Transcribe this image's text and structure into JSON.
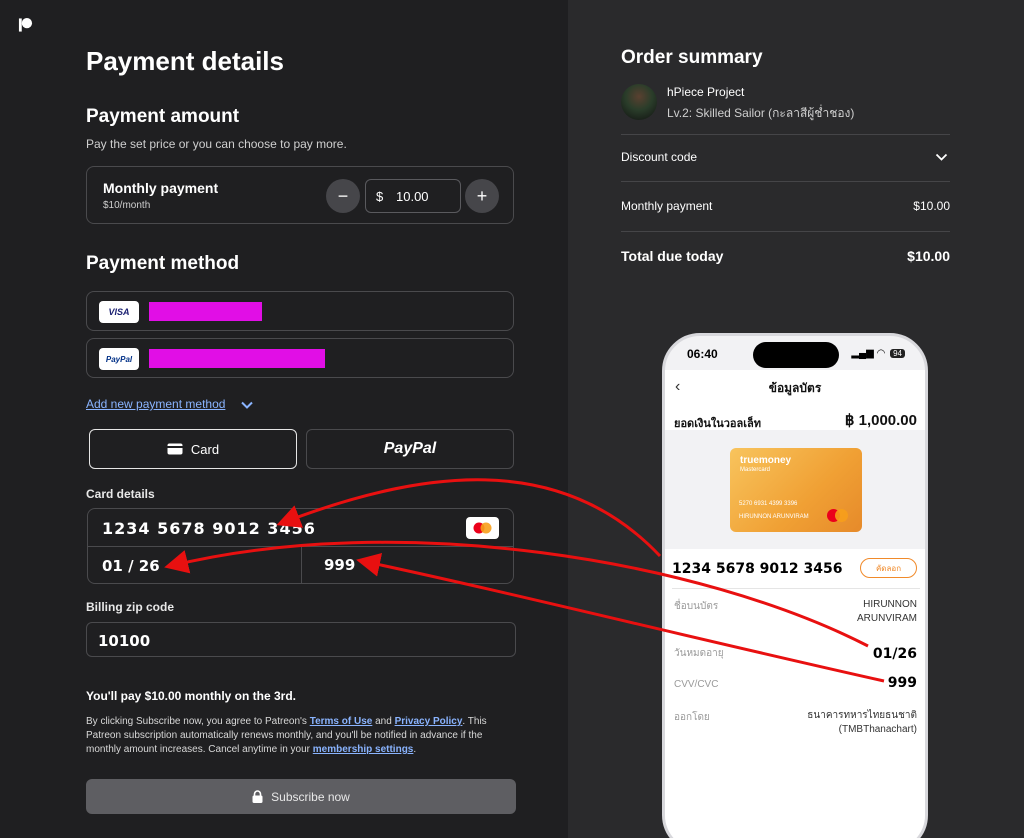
{
  "left": {
    "title": "Payment details",
    "amount_heading": "Payment amount",
    "amount_sub": "Pay the set price or you can choose to pay more.",
    "monthly_label": "Monthly payment",
    "monthly_sub": "$10/month",
    "decrement": "−",
    "currency": "$",
    "amount_value": "10.00",
    "increment": "+",
    "method_heading": "Payment method",
    "visa_logo": "VISA",
    "paypal_logo": "PayPal",
    "add_method": "Add new payment method",
    "tab_card": "Card",
    "tab_paypal": "PayPal",
    "card_details_label": "Card details",
    "card_number": "1234 5678 9012 3456",
    "card_expiry": "01 / 26",
    "card_cvv": "999",
    "zip_label": "Billing zip code",
    "zip_value": "10100",
    "pay_note": "You'll pay $10.00 monthly on the 3rd.",
    "legal_1": "By clicking Subscribe now, you agree to Patreon's ",
    "legal_terms": "Terms of Use",
    "legal_2": " and ",
    "legal_privacy": "Privacy Policy",
    "legal_3": ". This Patreon subscription automatically renews monthly, and you'll be notified in advance if the monthly amount increases. Cancel anytime in your ",
    "legal_membership": "membership settings",
    "legal_4": ".",
    "subscribe": "Subscribe now"
  },
  "summary": {
    "title": "Order summary",
    "project": "hPiece Project",
    "tier": "Lv.2: Skilled Sailor (กะลาสีผู้ช่ำชอง)",
    "discount": "Discount code",
    "monthly_label": "Monthly payment",
    "monthly_value": "$10.00",
    "total_label": "Total due today",
    "total_value": "$10.00"
  },
  "phone": {
    "time": "06:40",
    "battery": "94",
    "title": "ข้อมูลบัตร",
    "balance_label": "ยอดเงินในวอลเล็ท",
    "balance_value": "฿ 1,000.00",
    "card_brand": "truemoney",
    "card_brand_sub": "Mastercard",
    "card_masked": "5270 6931 4399 3396",
    "card_holder_print": "HIRUNNON ARUNVIRAM",
    "card_number": "1234 5678 9012 3456",
    "copy": "คัดลอก",
    "name_label": "ชื่อบนบัตร",
    "name_line1": "HIRUNNON",
    "name_line2": "ARUNVIRAM",
    "exp_label": "วันหมดอายุ",
    "exp_value": "01/26",
    "cvv_label": "CVV/CVC",
    "cvv_value": "999",
    "issuer_label": "ออกโดย",
    "issuer_line1": "ธนาคารทหารไทยธนชาติ",
    "issuer_line2": "(TMBThanachart)"
  },
  "colors": {
    "accent_link": "#8ab4ff",
    "redaction": "#e10ee6",
    "arrow": "#e81010",
    "truemoney_orange": "#f0a034"
  }
}
